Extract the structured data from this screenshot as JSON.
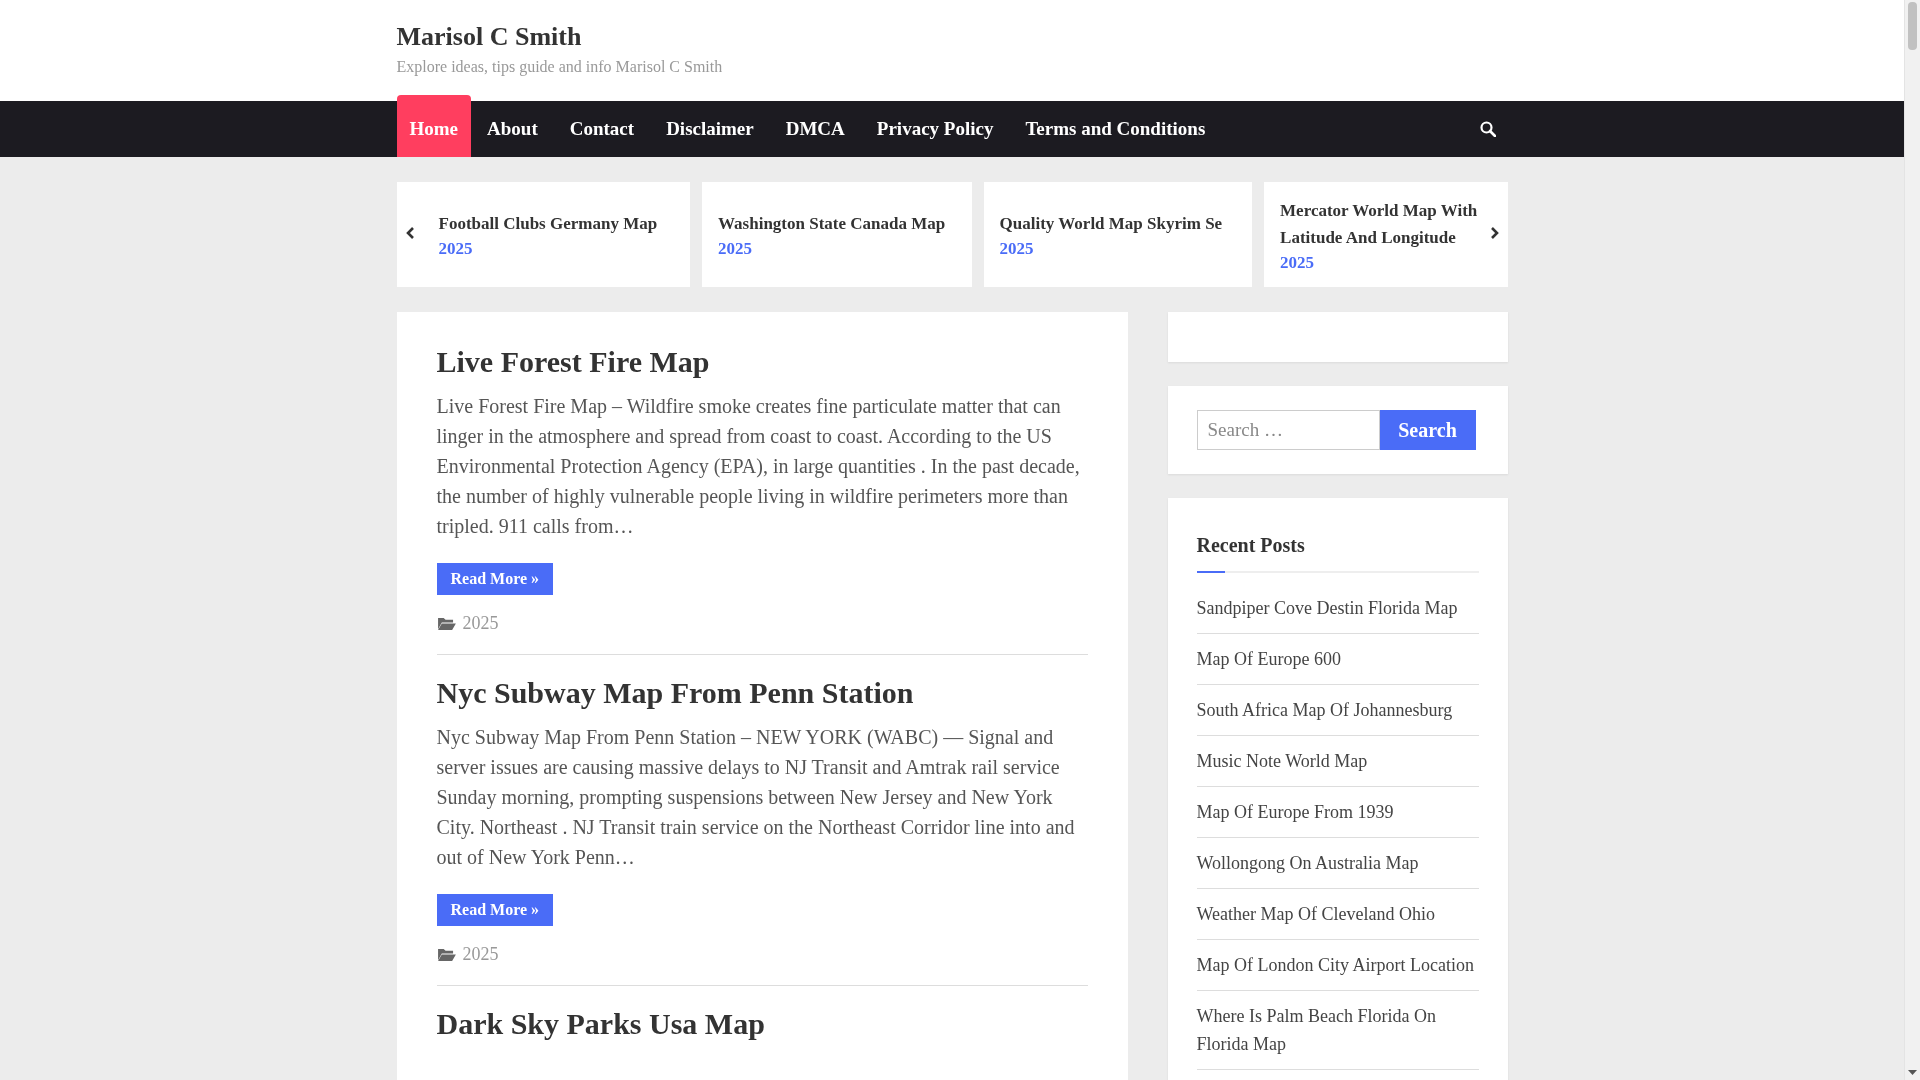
{
  "site": {
    "title": "Marisol C Smith",
    "tagline": "Explore ideas, tips guide and info Marisol C Smith"
  },
  "nav": {
    "items": [
      {
        "label": "Home",
        "selected": true
      },
      {
        "label": "About",
        "selected": false
      },
      {
        "label": "Contact",
        "selected": false
      },
      {
        "label": "Disclaimer",
        "selected": false
      },
      {
        "label": "DMCA",
        "selected": false
      },
      {
        "label": "Privacy Policy",
        "selected": false
      },
      {
        "label": "Terms and Conditions",
        "selected": false
      }
    ]
  },
  "slider": {
    "items": [
      {
        "title": "Football Clubs Germany Map",
        "date": "2025"
      },
      {
        "title": "Washington State Canada Map",
        "date": "2025"
      },
      {
        "title": "Quality World Map Skyrim Se",
        "date": "2025"
      },
      {
        "title": "Mercator World Map With Latitude And Longitude",
        "date": "2025"
      }
    ]
  },
  "posts": [
    {
      "title": "Live Forest Fire Map",
      "excerpt": "Live Forest Fire Map – Wildfire smoke creates fine particulate matter that can linger in the atmosphere and spread from coast to coast. According to the US Environmental Protection Agency (EPA), in large quantities . In the past decade, the number of highly vulnerable people living in wildfire perimeters more than tripled. 911 calls from…",
      "button": "Read More »",
      "category": "2025"
    },
    {
      "title": "Nyc Subway Map From Penn Station",
      "excerpt": "Nyc Subway Map From Penn Station – NEW YORK (WABC) — Signal and server issues are causing massive delays to NJ Transit and Amtrak rail service Sunday morning, prompting suspensions between New Jersey and New York City. Northeast . NJ Transit train service on the Northeast Corridor line into and out of New York Penn…",
      "button": "Read More »",
      "category": "2025"
    },
    {
      "title": "Dark Sky Parks Usa Map"
    }
  ],
  "sidebar": {
    "search": {
      "placeholder": "Search …",
      "button": "Search"
    },
    "recent_posts": {
      "title": "Recent Posts",
      "items": [
        "Sandpiper Cove Destin Florida Map",
        "Map Of Europe 600",
        "South Africa Map Of Johannesburg",
        "Music Note World Map",
        "Map Of Europe From 1939",
        "Wollongong On Australia Map",
        "Weather Map Of Cleveland Ohio",
        "Map Of London City Airport Location",
        "Where Is Palm Beach Florida On Florida Map"
      ]
    }
  }
}
